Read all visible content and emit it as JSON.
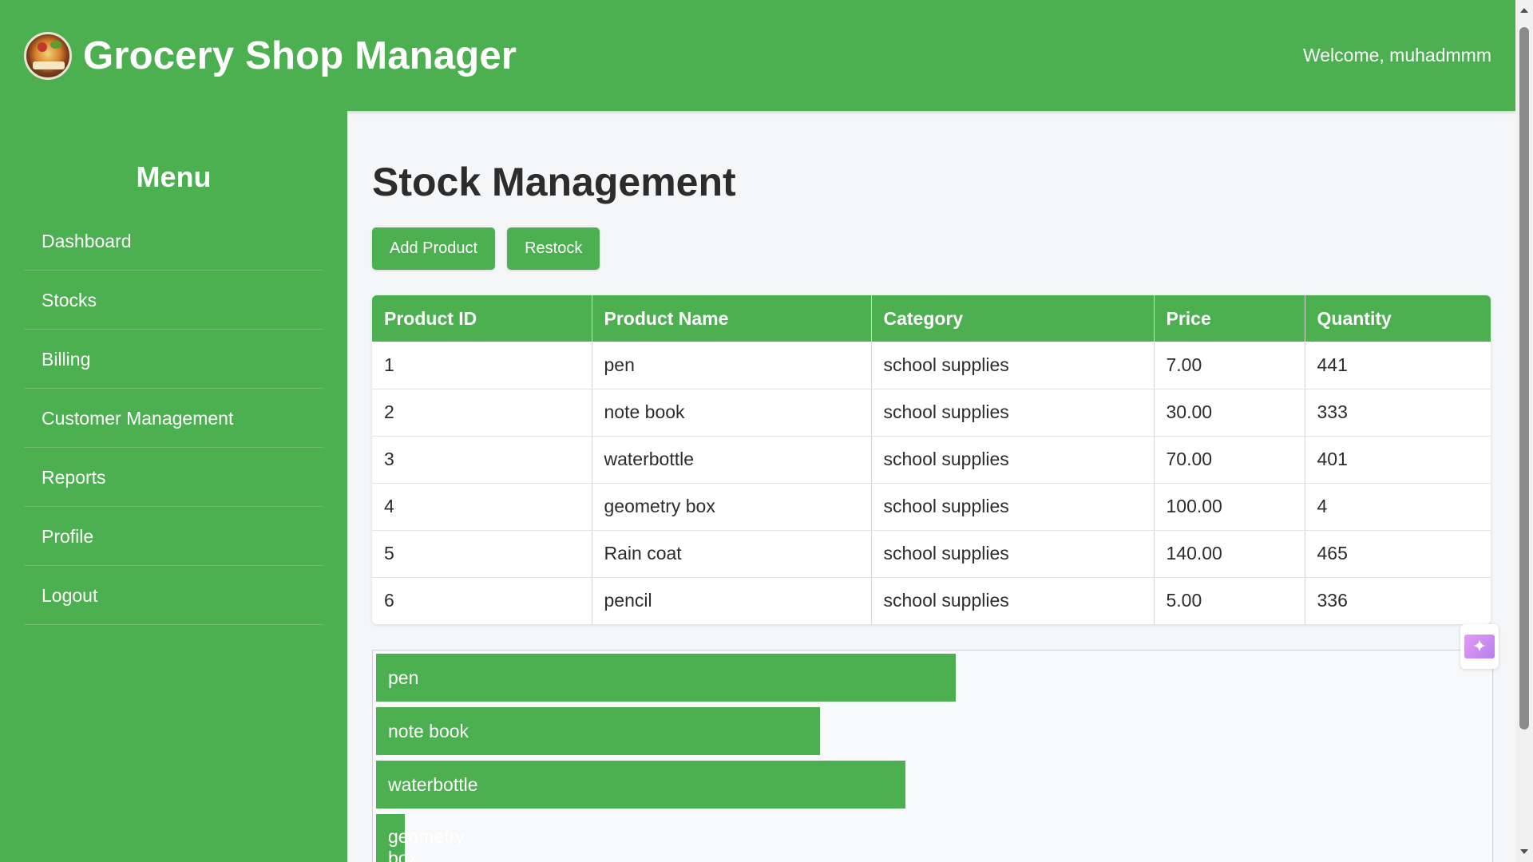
{
  "header": {
    "title": "Grocery Shop Manager",
    "welcome": "Welcome, muhadmmm",
    "logo_icon": "grocery-basket-logo"
  },
  "sidebar": {
    "menu_title": "Menu",
    "items": [
      {
        "label": "Dashboard"
      },
      {
        "label": "Stocks"
      },
      {
        "label": "Billing"
      },
      {
        "label": "Customer Management"
      },
      {
        "label": "Reports"
      },
      {
        "label": "Profile"
      },
      {
        "label": "Logout"
      }
    ]
  },
  "main": {
    "page_title": "Stock Management",
    "buttons": {
      "add_product": "Add Product",
      "restock": "Restock"
    },
    "table": {
      "headers": [
        "Product ID",
        "Product Name",
        "Category",
        "Price",
        "Quantity"
      ],
      "rows": [
        [
          "1",
          "pen",
          "school supplies",
          "7.00",
          "441"
        ],
        [
          "2",
          "note book",
          "school supplies",
          "30.00",
          "333"
        ],
        [
          "3",
          "waterbottle",
          "school supplies",
          "70.00",
          "401"
        ],
        [
          "4",
          "geometry box",
          "school supplies",
          "100.00",
          "4"
        ],
        [
          "5",
          "Rain coat",
          "school supplies",
          "140.00",
          "465"
        ],
        [
          "6",
          "pencil",
          "school supplies",
          "5.00",
          "336"
        ]
      ]
    },
    "stock_bars": [
      {
        "label": "pen",
        "quantity": 441
      },
      {
        "label": "note book",
        "quantity": 333
      },
      {
        "label": "waterbottle",
        "quantity": 401
      },
      {
        "label": "geometry box",
        "quantity": 4
      }
    ]
  },
  "colors": {
    "primary": "#4caf50",
    "background": "#f4f6f8",
    "text": "#2c2c2c"
  },
  "icons": {
    "assistant": "sparkle-chat-icon"
  }
}
